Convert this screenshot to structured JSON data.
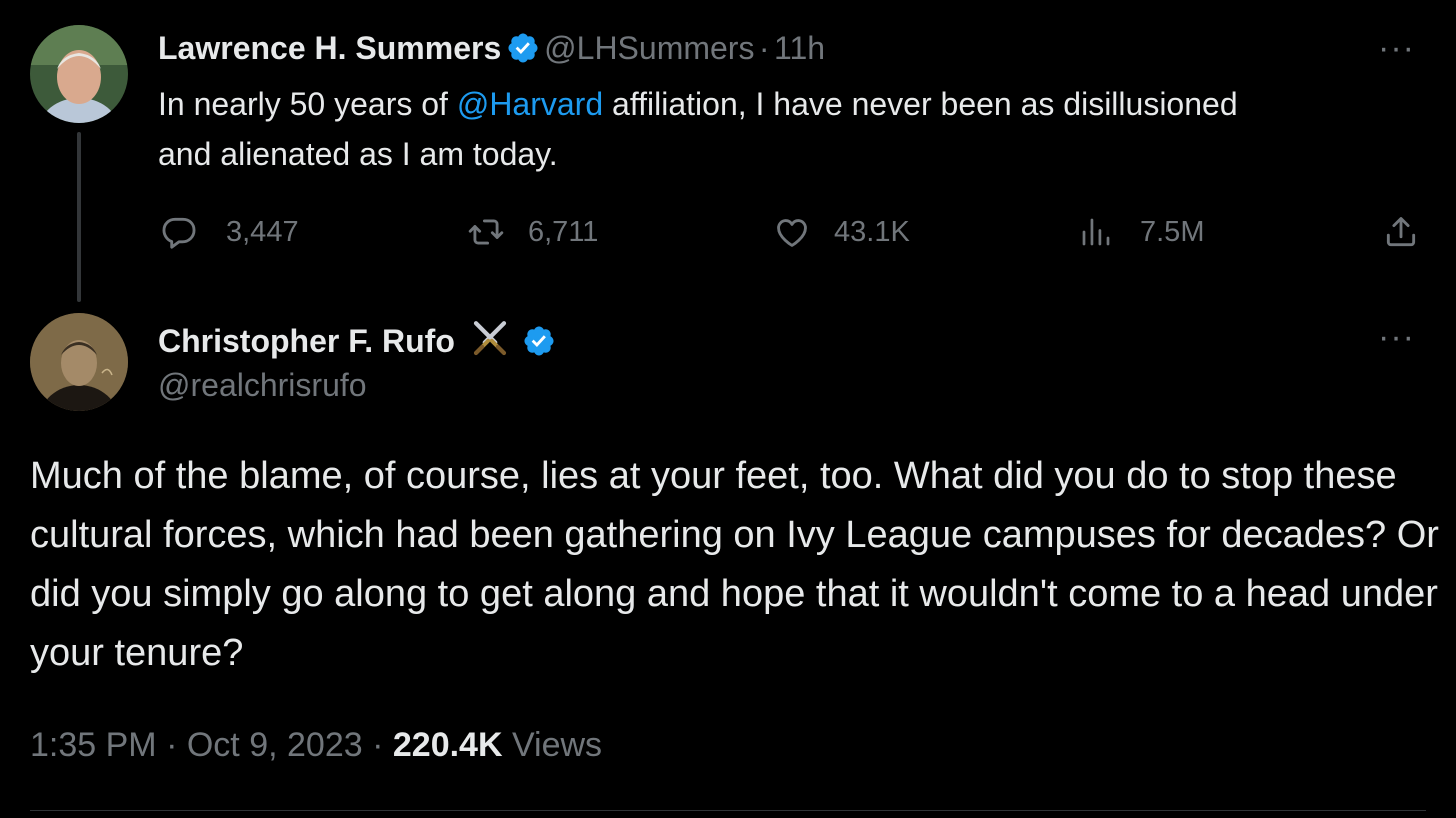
{
  "quoted_tweet": {
    "author_name": "Lawrence H. Summers",
    "handle": "@LHSummers",
    "separator": "·",
    "time": "11h",
    "text_before": "In nearly 50 years of ",
    "mention": "@Harvard",
    "text_after": " affiliation, I have never been as disillusioned and alienated as I am today.",
    "replies": "3,447",
    "reposts": "6,711",
    "likes": "43.1K",
    "views": "7.5M",
    "more_label": "···"
  },
  "main_tweet": {
    "author_name": "Christopher F. Rufo",
    "handle": "@realchrisrufo",
    "text": "Much of the blame, of course, lies at your feet, too. What did you do to stop these cultural forces, which had been gathering on Ivy League campuses for decades? Or did you simply go along to get along and hope that it wouldn't come to a head under your tenure?",
    "time": "1:35 PM",
    "separator": "·",
    "date": "Oct 9, 2023",
    "views_count": "220.4K",
    "views_label": "Views",
    "more_label": "···"
  },
  "colors": {
    "background": "#000000",
    "text": "#e7e9ea",
    "secondary": "#71767b",
    "accent": "#1d9bf0"
  },
  "icons": [
    "reply-icon",
    "repost-icon",
    "like-icon",
    "views-icon",
    "share-icon",
    "verified-badge-icon",
    "crossed-swords-emoji"
  ]
}
